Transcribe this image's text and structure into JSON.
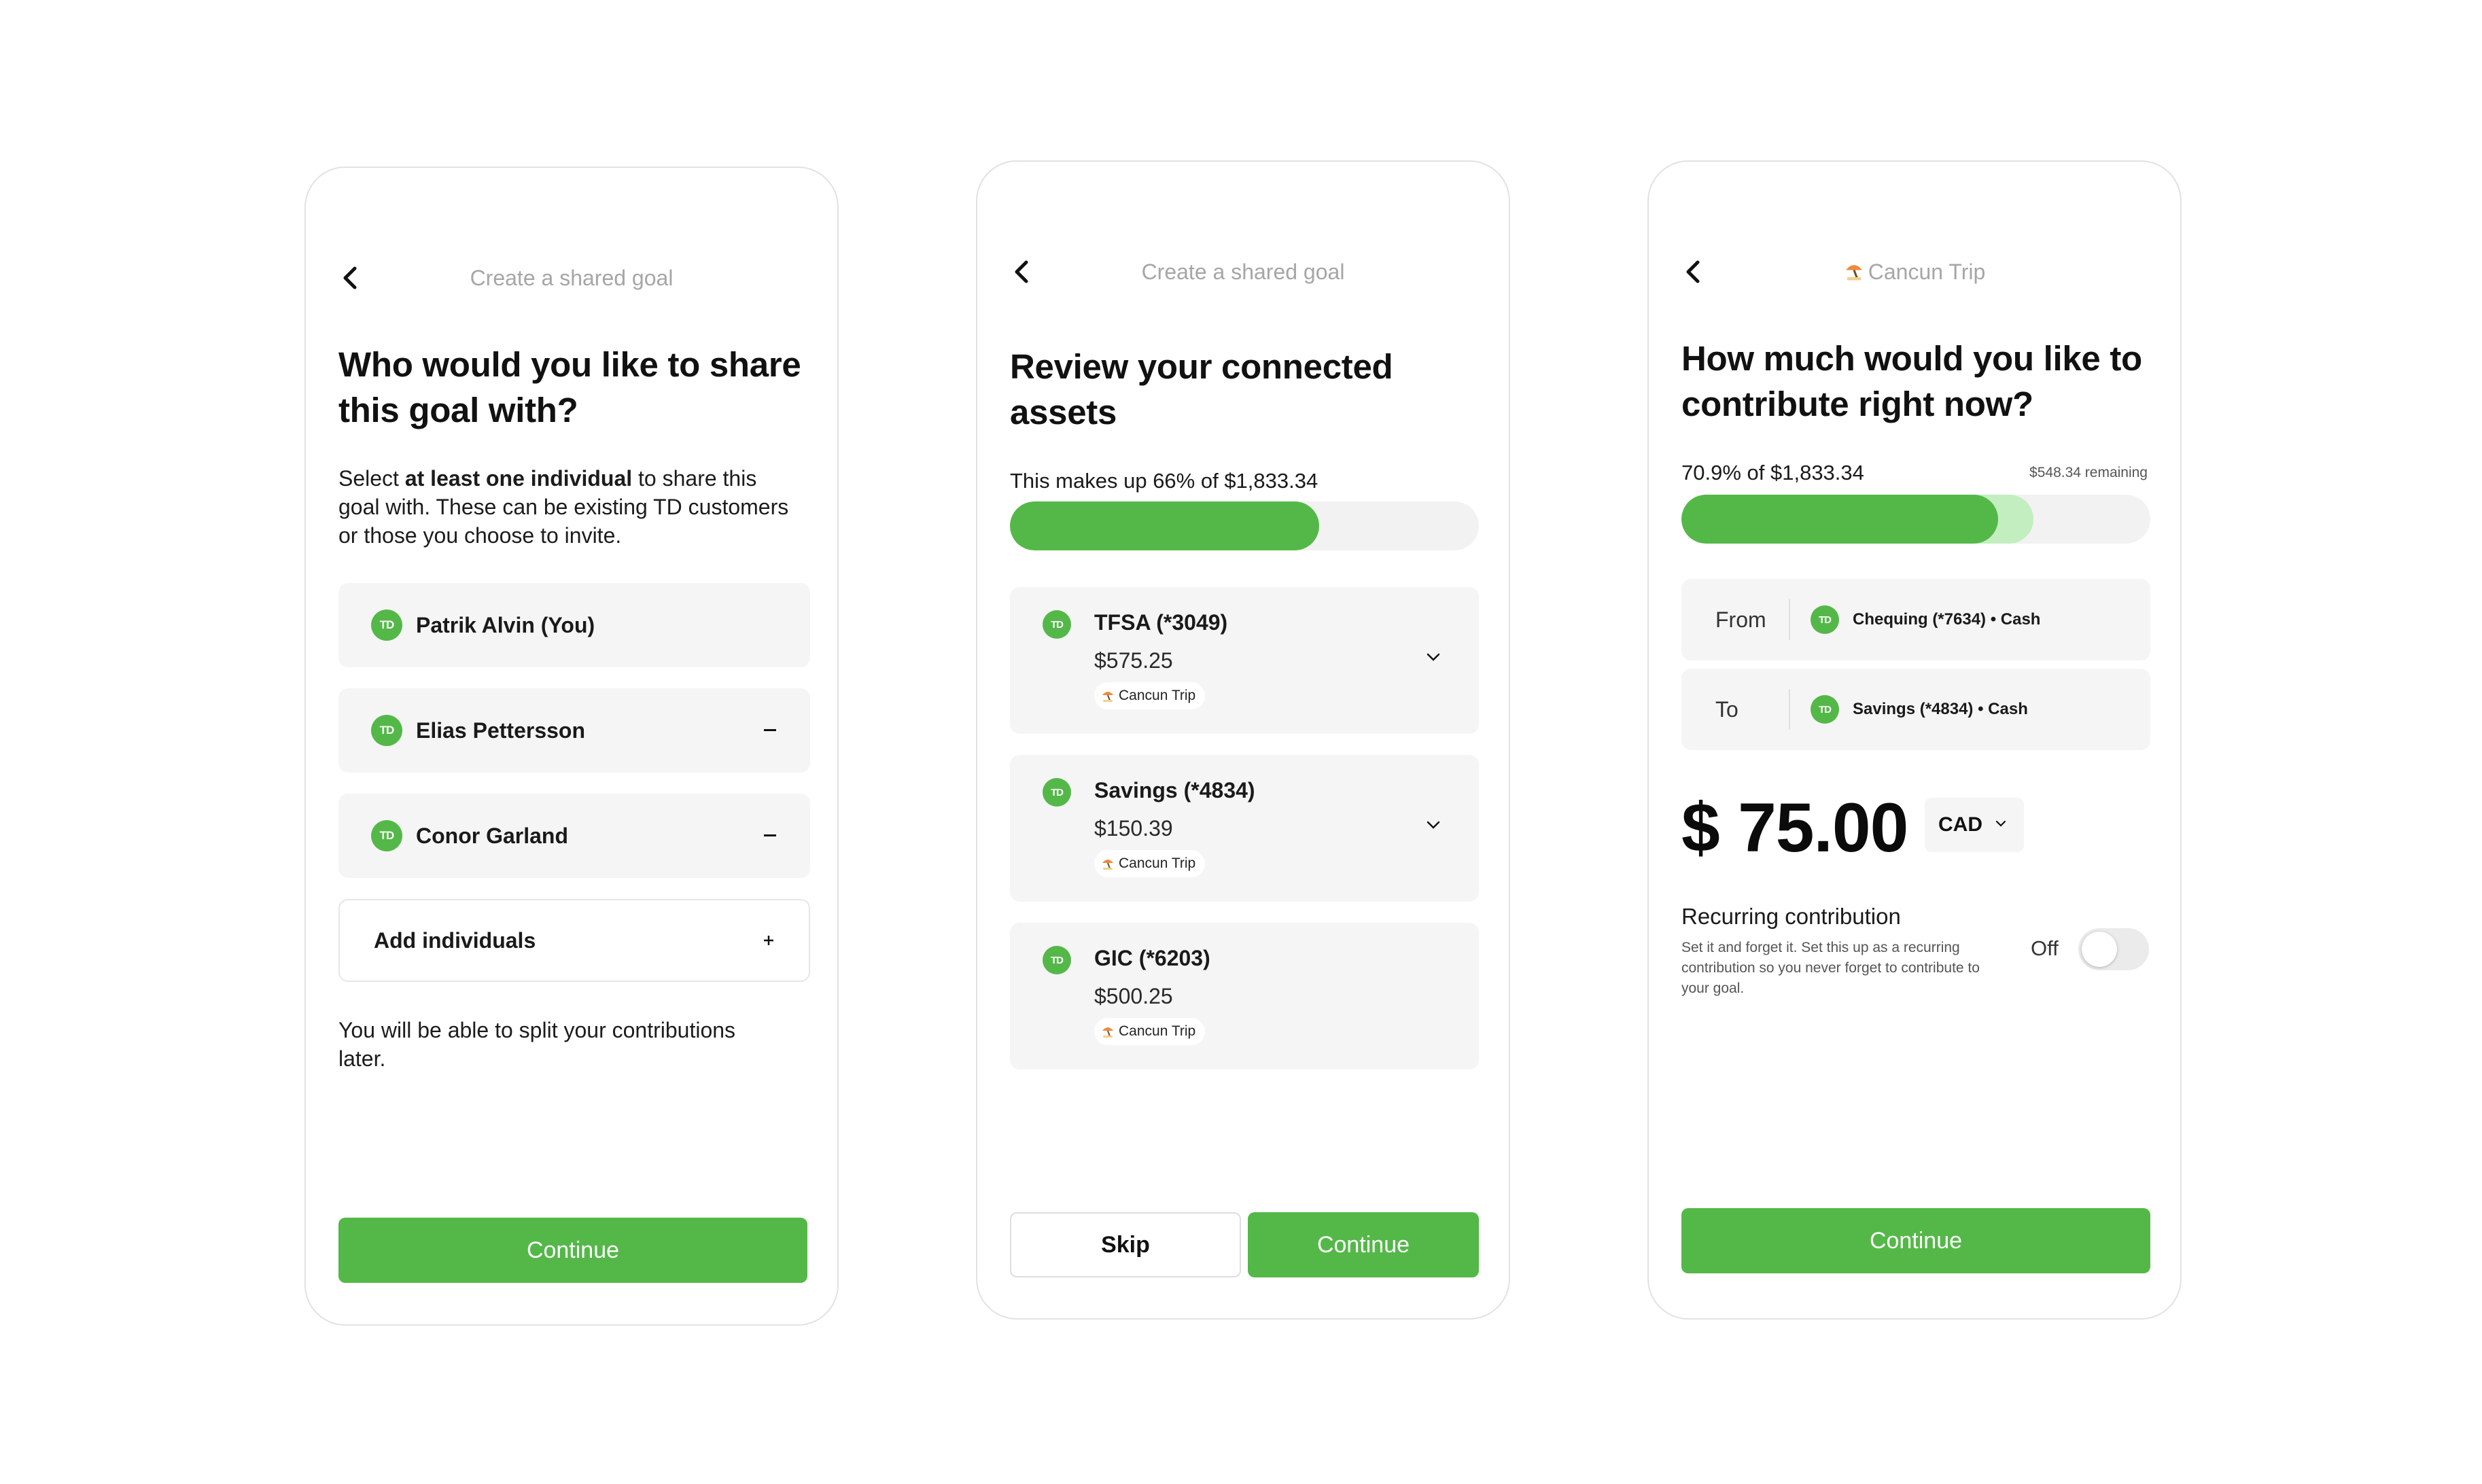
{
  "colors": {
    "accent": "#54b848",
    "accent_light": "#c3eec0",
    "card_bg": "#f5f5f5",
    "muted_text": "#a6a6a6"
  },
  "screen1": {
    "nav_title": "Create a shared goal",
    "heading": "Who would you like to share this goal with?",
    "description_pre": "Select ",
    "description_bold": "at least one individual",
    "description_post": " to share this goal with. These can be existing TD customers or those you choose to invite.",
    "logo_text": "TD",
    "people": [
      {
        "name": "Patrik Alvin (You)",
        "removable": false
      },
      {
        "name": "Elias Pettersson",
        "removable": true
      },
      {
        "name": "Conor Garland",
        "removable": true
      }
    ],
    "add_label": "Add individuals",
    "footnote": "You will be able to split your contributions later.",
    "continue_label": "Continue"
  },
  "screen2": {
    "nav_title": "Create a shared goal",
    "heading": "Review your connected assets",
    "progress_label": "This makes up 66% of $1,833.34",
    "progress_fraction": 0.66,
    "accounts": [
      {
        "name": "TFSA (*3049)",
        "balance": "$575.25",
        "goal": "Cancun Trip",
        "expandable": true
      },
      {
        "name": "Savings (*4834)",
        "balance": "$150.39",
        "goal": "Cancun Trip",
        "expandable": true
      },
      {
        "name": "GIC (*6203)",
        "balance": "$500.25",
        "goal": "Cancun Trip",
        "expandable": false
      }
    ],
    "skip_label": "Skip",
    "continue_label": "Continue"
  },
  "screen3": {
    "nav_title": "Cancun Trip",
    "heading": "How much would you like to contribute right now?",
    "progress_label": "70.9% of $1,833.34",
    "remaining_label": "$548.34 remaining",
    "progress_fraction": 0.676,
    "projected_fraction": 0.751,
    "from_label": "From",
    "from_account": "Chequing (*7634) • Cash",
    "to_label": "To",
    "to_account": "Savings (*4834) • Cash",
    "amount": "$ 75.00",
    "currency": "CAD",
    "recurring_title": "Recurring contribution",
    "recurring_desc": "Set it and forget it. Set this up as a recurring contribution so you never forget to contribute to your goal.",
    "toggle_label": "Off",
    "toggle_on": false,
    "continue_label": "Continue"
  }
}
